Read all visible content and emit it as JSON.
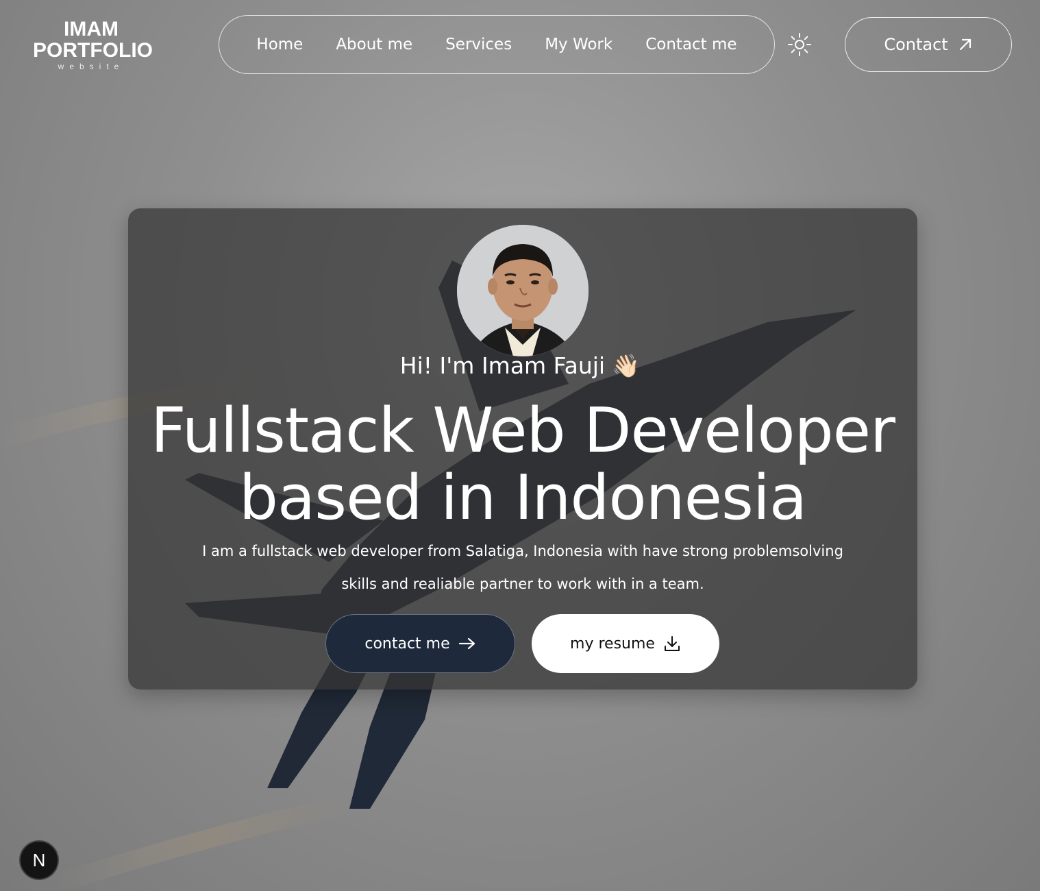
{
  "logo": {
    "line1": "IMAM",
    "line2": "PORTFOLIO",
    "line3": "website"
  },
  "nav": {
    "items": [
      {
        "label": "Home"
      },
      {
        "label": "About me"
      },
      {
        "label": "Services"
      },
      {
        "label": "My Work"
      },
      {
        "label": "Contact me"
      }
    ]
  },
  "header": {
    "theme_icon": "sun-icon",
    "contact_label": "Contact",
    "contact_icon": "arrow-up-right-icon"
  },
  "hero": {
    "greeting": "Hi! I'm Imam Fauji",
    "greeting_emoji": "👋🏻",
    "headline_line1": "Fullstack Web Developer",
    "headline_line2": "based in Indonesia",
    "bio": "I am a fullstack web developer from Salatiga, Indonesia with have strong problemsolving skills and realiable partner to work with in a team.",
    "primary_button": {
      "label": "contact me",
      "icon": "arrow-right-icon"
    },
    "secondary_button": {
      "label": "my resume",
      "icon": "download-icon"
    }
  },
  "badge": {
    "label": "N"
  },
  "colors": {
    "card_bg": "#343434",
    "primary_button_bg": "#1e2a3c",
    "secondary_button_bg": "#ffffff",
    "text": "#ffffff"
  }
}
